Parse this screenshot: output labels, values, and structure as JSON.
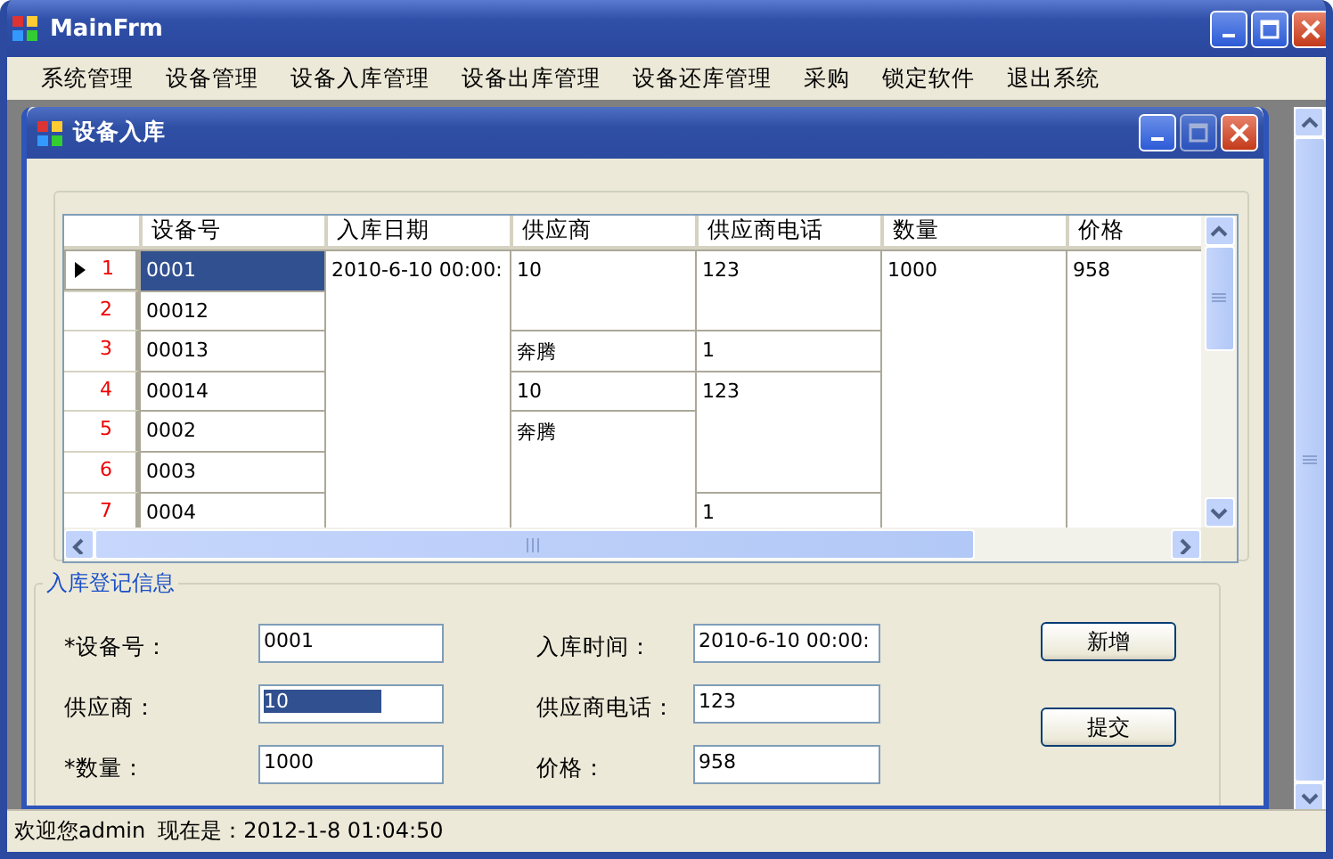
{
  "window": {
    "title": "MainFrm"
  },
  "menu": [
    "系统管理",
    "设备管理",
    "设备入库管理",
    "设备出库管理",
    "设备还库管理",
    "采购",
    "锁定软件",
    "退出系统"
  ],
  "child_window": {
    "title": "设备入库"
  },
  "grid": {
    "columns": [
      "设备号",
      "入库日期",
      "供应商",
      "供应商电话",
      "数量",
      "价格"
    ],
    "rows": [
      {
        "number": "1",
        "current": true,
        "first_cell_selected": true,
        "cells": [
          "0001",
          "2010-6-10 00:00:",
          "10",
          "123",
          "1000",
          "958"
        ]
      },
      {
        "number": "2",
        "current": false,
        "first_cell_selected": false,
        "cells": [
          "00012",
          null,
          null,
          null,
          null,
          null
        ]
      },
      {
        "number": "3",
        "current": false,
        "first_cell_selected": false,
        "cells": [
          "00013",
          null,
          "奔腾",
          "1",
          null,
          null
        ]
      },
      {
        "number": "4",
        "current": false,
        "first_cell_selected": false,
        "cells": [
          "00014",
          null,
          "10",
          "123",
          null,
          null
        ]
      },
      {
        "number": "5",
        "current": false,
        "first_cell_selected": false,
        "cells": [
          "0002",
          null,
          "奔腾",
          null,
          null,
          null
        ]
      },
      {
        "number": "6",
        "current": false,
        "first_cell_selected": false,
        "cells": [
          "0003",
          null,
          null,
          null,
          null,
          null
        ]
      },
      {
        "number": "7",
        "current": false,
        "first_cell_selected": false,
        "cells": [
          "0004",
          null,
          null,
          "1",
          null,
          null
        ]
      }
    ]
  },
  "form": {
    "title": "入库登记信息",
    "fields": [
      {
        "label": "*设备号：",
        "value": "0001",
        "text_selected": false
      },
      {
        "label": "入库时间：",
        "value": "2010-6-10 00:00:",
        "text_selected": false
      },
      {
        "label": "供应商：",
        "value": "10",
        "text_selected": true
      },
      {
        "label": "供应商电话：",
        "value": "123",
        "text_selected": false
      },
      {
        "label": "*数量：",
        "value": "1000",
        "text_selected": false
      },
      {
        "label": "价格：",
        "value": "958",
        "text_selected": false
      }
    ],
    "buttons": [
      "新增",
      "提交"
    ]
  },
  "status_bar": {
    "user": "欢迎您admin",
    "time": "现在是：2012-1-8 01:04:50"
  }
}
